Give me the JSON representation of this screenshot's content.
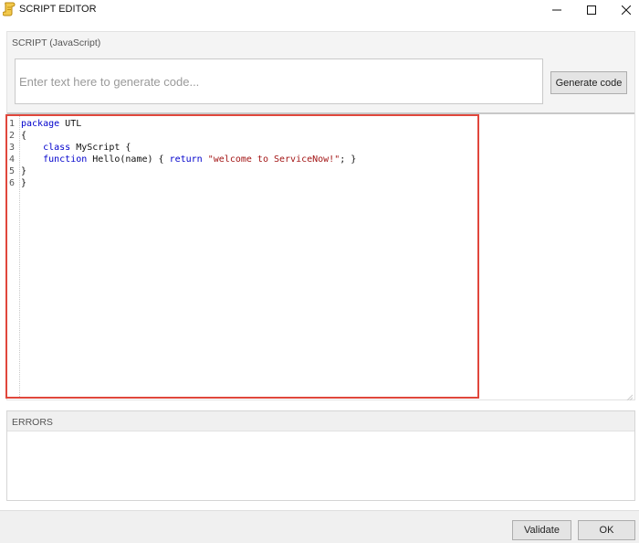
{
  "window": {
    "title": "SCRIPT EDITOR",
    "app_icon": "scroll-icon",
    "controls": [
      "minimize-icon",
      "maximize-icon",
      "close-icon"
    ]
  },
  "script_panel": {
    "header": "SCRIPT (JavaScript)",
    "prompt_input": {
      "value": "",
      "placeholder": "Enter text here to generate code..."
    },
    "generate_button": "Generate code"
  },
  "code_editor": {
    "lines": [
      {
        "number": "1",
        "parts": [
          {
            "t": "package",
            "c": "kw"
          },
          {
            "t": " UTL",
            "c": ""
          }
        ]
      },
      {
        "number": "2",
        "parts": [
          {
            "t": "{",
            "c": ""
          }
        ]
      },
      {
        "number": "3",
        "parts": [
          {
            "t": "    ",
            "c": ""
          },
          {
            "t": "class",
            "c": "kw"
          },
          {
            "t": " MyScript {",
            "c": ""
          }
        ]
      },
      {
        "number": "4",
        "parts": [
          {
            "t": "    ",
            "c": ""
          },
          {
            "t": "function",
            "c": "kw"
          },
          {
            "t": " Hello(name) { ",
            "c": ""
          },
          {
            "t": "return",
            "c": "kw"
          },
          {
            "t": " ",
            "c": ""
          },
          {
            "t": "\"welcome to ServiceNow!\"",
            "c": "str"
          },
          {
            "t": "; }",
            "c": ""
          }
        ]
      },
      {
        "number": "5",
        "parts": [
          {
            "t": "}",
            "c": ""
          }
        ]
      },
      {
        "number": "6",
        "parts": [
          {
            "t": "}",
            "c": ""
          }
        ]
      }
    ],
    "highlight_color": "#e0473c",
    "keyword_color": "#0000cc",
    "string_color": "#a31515"
  },
  "errors_panel": {
    "header": "ERRORS"
  },
  "footer": {
    "validate_button": "Validate",
    "ok_button": "OK"
  }
}
